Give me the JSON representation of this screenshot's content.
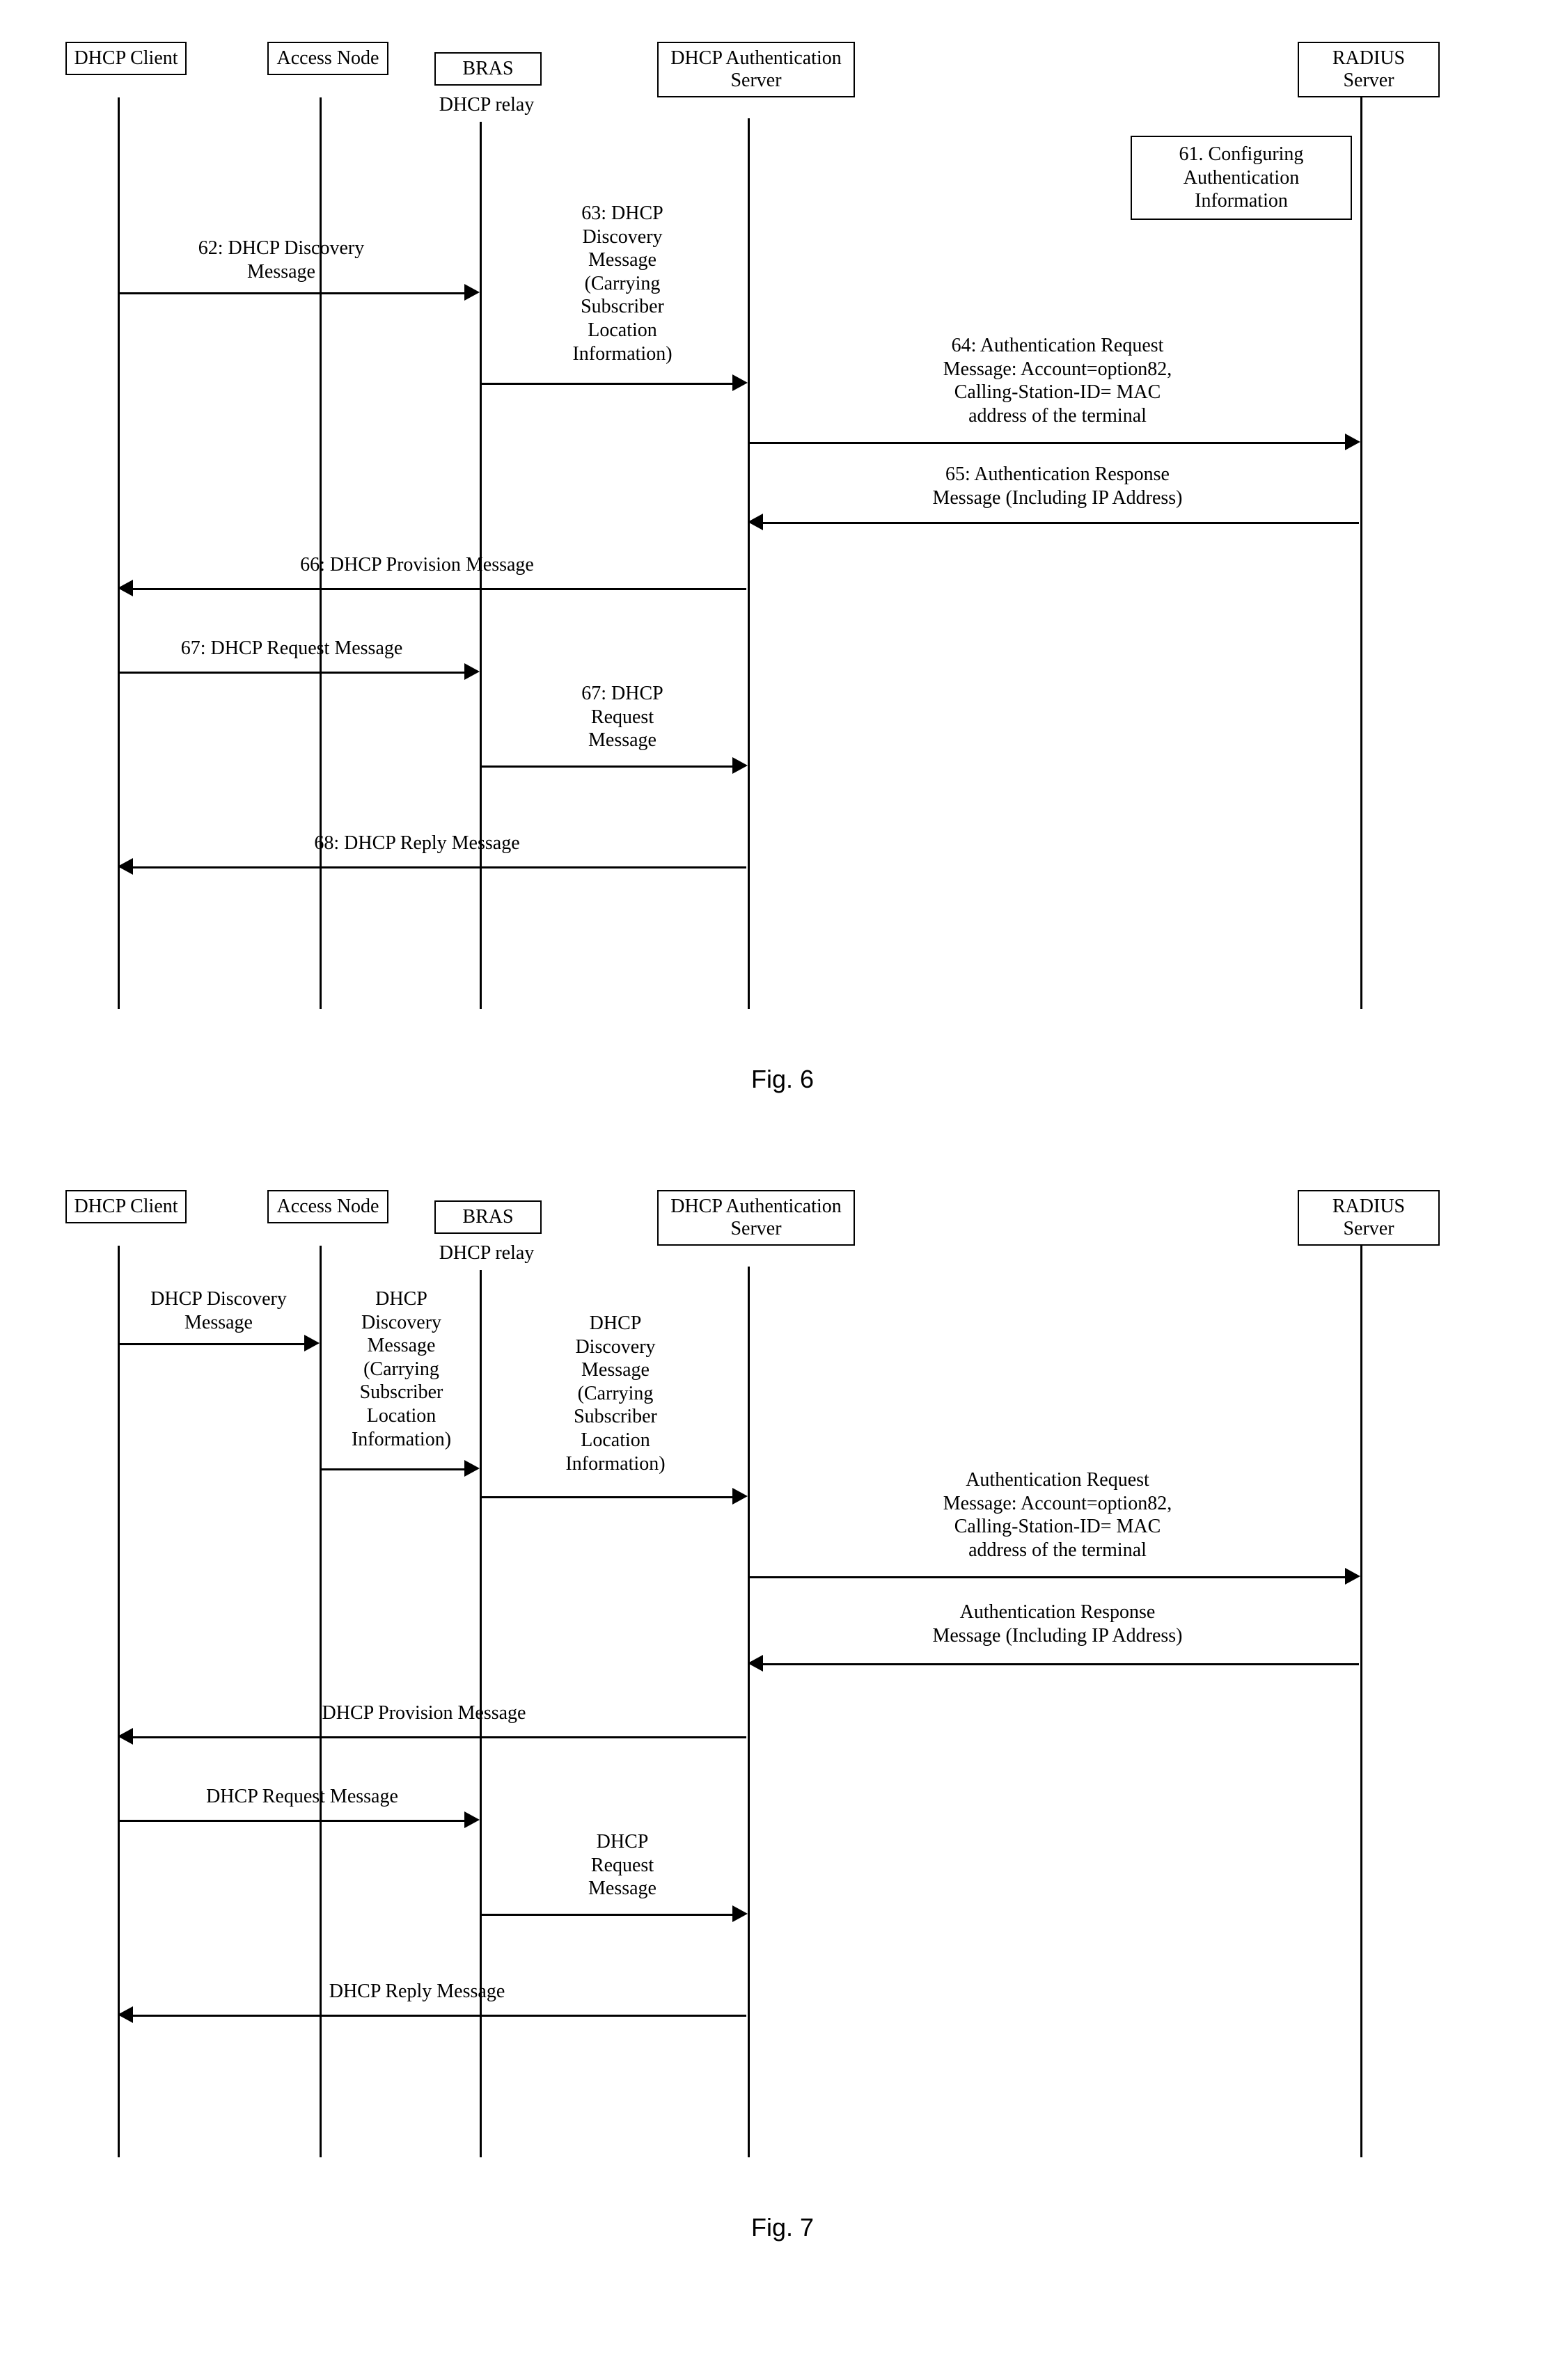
{
  "fig6": {
    "actors": {
      "client": "DHCP\nClient",
      "access": "Access\nNode",
      "bras": "BRAS",
      "auth": "DHCP\nAuthentication\nServer",
      "radius": "RADIUS\nServer"
    },
    "relay": "DHCP relay",
    "note61": "61. Configuring\nAuthentication\nInformation",
    "m62": "62: DHCP Discovery\nMessage",
    "m63": "63: DHCP\nDiscovery\nMessage\n(Carrying\nSubscriber\nLocation\nInformation)",
    "m64": "64: Authentication Request\nMessage: Account=option82,\nCalling-Station-ID= MAC\naddress of the terminal",
    "m65": "65: Authentication Response\nMessage (Including IP Address)",
    "m66": "66: DHCP Provision Message",
    "m67a": "67: DHCP Request Message",
    "m67b": "67: DHCP\nRequest\nMessage",
    "m68": "68: DHCP Reply Message",
    "caption": "Fig. 6"
  },
  "fig7": {
    "actors": {
      "client": "DHCP\nClient",
      "access": "Access\nNode",
      "bras": "BRAS",
      "auth": "DHCP\nAuthentication\nServer",
      "radius": "RADIUS\nServer"
    },
    "relay": "DHCP relay",
    "m_disc1": "DHCP Discovery\nMessage",
    "m_disc2": "DHCP\nDiscovery\nMessage\n(Carrying\nSubscriber\nLocation\nInformation)",
    "m_disc3": "DHCP\nDiscovery\nMessage\n(Carrying\nSubscriber\nLocation\nInformation)",
    "m_authreq": "Authentication Request\nMessage: Account=option82,\nCalling-Station-ID= MAC\naddress of the terminal",
    "m_authresp": "Authentication Response\nMessage (Including IP Address)",
    "m_prov": "DHCP Provision Message",
    "m_req1": "DHCP Request Message",
    "m_req2": "DHCP\nRequest\nMessage",
    "m_reply": "DHCP Reply Message",
    "caption": "Fig. 7"
  },
  "chart_data": [
    {
      "type": "sequence",
      "title": "Fig. 6",
      "actors": [
        "DHCP Client",
        "Access Node",
        "BRAS (DHCP relay)",
        "DHCP Authentication Server",
        "RADIUS Server"
      ],
      "steps": [
        {
          "id": "61",
          "at": "RADIUS Server",
          "kind": "note",
          "text": "Configuring Authentication Information"
        },
        {
          "id": "62",
          "from": "DHCP Client",
          "to": "BRAS (DHCP relay)",
          "text": "DHCP Discovery Message"
        },
        {
          "id": "63",
          "from": "BRAS (DHCP relay)",
          "to": "DHCP Authentication Server",
          "text": "DHCP Discovery Message (Carrying Subscriber Location Information)"
        },
        {
          "id": "64",
          "from": "DHCP Authentication Server",
          "to": "RADIUS Server",
          "text": "Authentication Request Message: Account=option82, Calling-Station-ID= MAC address of the terminal"
        },
        {
          "id": "65",
          "from": "RADIUS Server",
          "to": "DHCP Authentication Server",
          "text": "Authentication Response Message (Including IP Address)"
        },
        {
          "id": "66",
          "from": "DHCP Authentication Server",
          "to": "DHCP Client",
          "text": "DHCP Provision Message"
        },
        {
          "id": "67",
          "from": "DHCP Client",
          "to": "BRAS (DHCP relay)",
          "text": "DHCP Request Message"
        },
        {
          "id": "67",
          "from": "BRAS (DHCP relay)",
          "to": "DHCP Authentication Server",
          "text": "DHCP Request Message"
        },
        {
          "id": "68",
          "from": "DHCP Authentication Server",
          "to": "DHCP Client",
          "text": "DHCP Reply Message"
        }
      ]
    },
    {
      "type": "sequence",
      "title": "Fig. 7",
      "actors": [
        "DHCP Client",
        "Access Node",
        "BRAS (DHCP relay)",
        "DHCP Authentication Server",
        "RADIUS Server"
      ],
      "steps": [
        {
          "from": "DHCP Client",
          "to": "Access Node",
          "text": "DHCP Discovery Message"
        },
        {
          "from": "Access Node",
          "to": "BRAS (DHCP relay)",
          "text": "DHCP Discovery Message (Carrying Subscriber Location Information)"
        },
        {
          "from": "BRAS (DHCP relay)",
          "to": "DHCP Authentication Server",
          "text": "DHCP Discovery Message (Carrying Subscriber Location Information)"
        },
        {
          "from": "DHCP Authentication Server",
          "to": "RADIUS Server",
          "text": "Authentication Request Message: Account=option82, Calling-Station-ID= MAC address of the terminal"
        },
        {
          "from": "RADIUS Server",
          "to": "DHCP Authentication Server",
          "text": "Authentication Response Message (Including IP Address)"
        },
        {
          "from": "DHCP Authentication Server",
          "to": "DHCP Client",
          "text": "DHCP Provision Message"
        },
        {
          "from": "DHCP Client",
          "to": "BRAS (DHCP relay)",
          "text": "DHCP Request Message"
        },
        {
          "from": "BRAS (DHCP relay)",
          "to": "DHCP Authentication Server",
          "text": "DHCP Request Message"
        },
        {
          "from": "DHCP Authentication Server",
          "to": "DHCP Client",
          "text": "DHCP Reply Message"
        }
      ]
    }
  ]
}
